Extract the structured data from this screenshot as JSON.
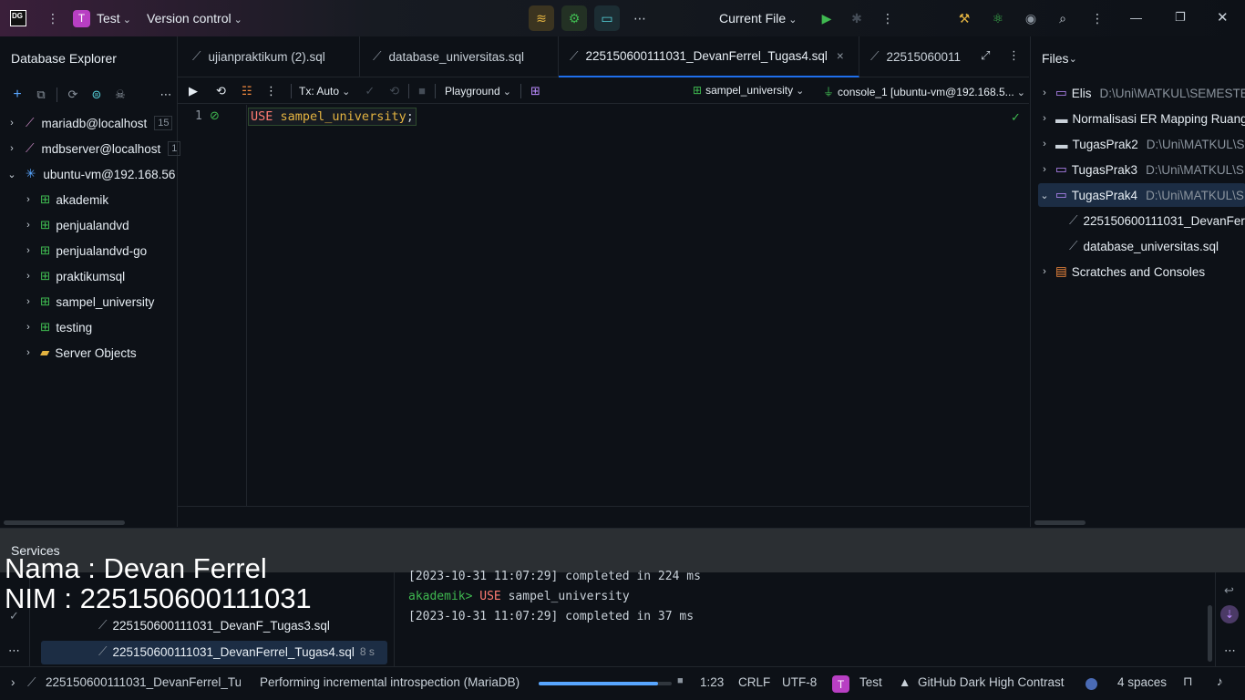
{
  "titlebar": {
    "logo": "DG",
    "project_avatar": "T",
    "project_name": "Test",
    "vcs_label": "Version control",
    "run_config": "Current File"
  },
  "db_explorer": {
    "title": "Database Explorer",
    "items": [
      {
        "label": "mariadb@localhost",
        "badge": "15"
      },
      {
        "label": "mdbserver@localhost",
        "badge": "1"
      },
      {
        "label": "ubuntu-vm@192.168.56",
        "badge": ""
      }
    ],
    "schemas": [
      "akademik",
      "penjualandvd",
      "penjualandvd-go",
      "praktikumsql",
      "sampel_university",
      "testing",
      "Server Objects"
    ]
  },
  "tabs": [
    {
      "label": "ujianpraktikum (2).sql"
    },
    {
      "label": "database_universitas.sql"
    },
    {
      "label": "225150600111031_DevanFerrel_Tugas4.sql",
      "close": "×"
    },
    {
      "label": "22515060011"
    }
  ],
  "editor_toolbar": {
    "tx": "Tx: Auto",
    "playground": "Playground",
    "schema": "sampel_university",
    "console": "console_1 [ubuntu-vm@192.168.5..."
  },
  "editor": {
    "line_number": "1",
    "kw": "USE",
    "ident": "sampel_university",
    "semi": ";"
  },
  "files": {
    "title": "Files",
    "items": [
      {
        "label": "Elis",
        "path": "D:\\Uni\\MATKUL\\SEMESTER"
      },
      {
        "label": "Normalisasi ER Mapping Ruang",
        "path": ""
      },
      {
        "label": "TugasPrak2",
        "path": "D:\\Uni\\MATKUL\\S"
      },
      {
        "label": "TugasPrak3",
        "path": "D:\\Uni\\MATKUL\\S"
      },
      {
        "label": "TugasPrak4",
        "path": "D:\\Uni\\MATKUL\\S"
      },
      {
        "label": "225150600111031_DevanFer",
        "path": ""
      },
      {
        "label": "database_universitas.sql",
        "path": ""
      },
      {
        "label": "Scratches and Consoles",
        "path": ""
      }
    ]
  },
  "services": {
    "title": "Services",
    "overlay_name": "Nama : Devan Ferrel",
    "overlay_nim": "NIM : 225150600111031",
    "tree": [
      {
        "label": "225150600111031_DevanF_Tugas3.sql",
        "time": ""
      },
      {
        "label": "225150600111031_DevanFerrel_Tugas4.sql",
        "time": "8 s"
      }
    ],
    "log": [
      {
        "text": "[2023-10-31 11:07:29] completed in 224 ms"
      },
      {
        "prompt": "akademik>",
        "kw": "USE",
        "rest": "sampel_university"
      },
      {
        "text": "[2023-10-31 11:07:29] completed in 37 ms"
      }
    ]
  },
  "statusbar": {
    "file": "225150600111031_DevanFerrel_Tu",
    "task": "Performing incremental introspection (MariaDB)",
    "progress": 0.9,
    "position": "1:23",
    "line_sep": "CRLF",
    "encoding": "UTF-8",
    "avatar": "T",
    "project": "Test",
    "theme": "GitHub Dark High Contrast",
    "indent": "4 spaces"
  },
  "colors": {
    "accent": "#1f6feb",
    "keyword": "#ff7b72",
    "prompt": "#3fb950"
  }
}
